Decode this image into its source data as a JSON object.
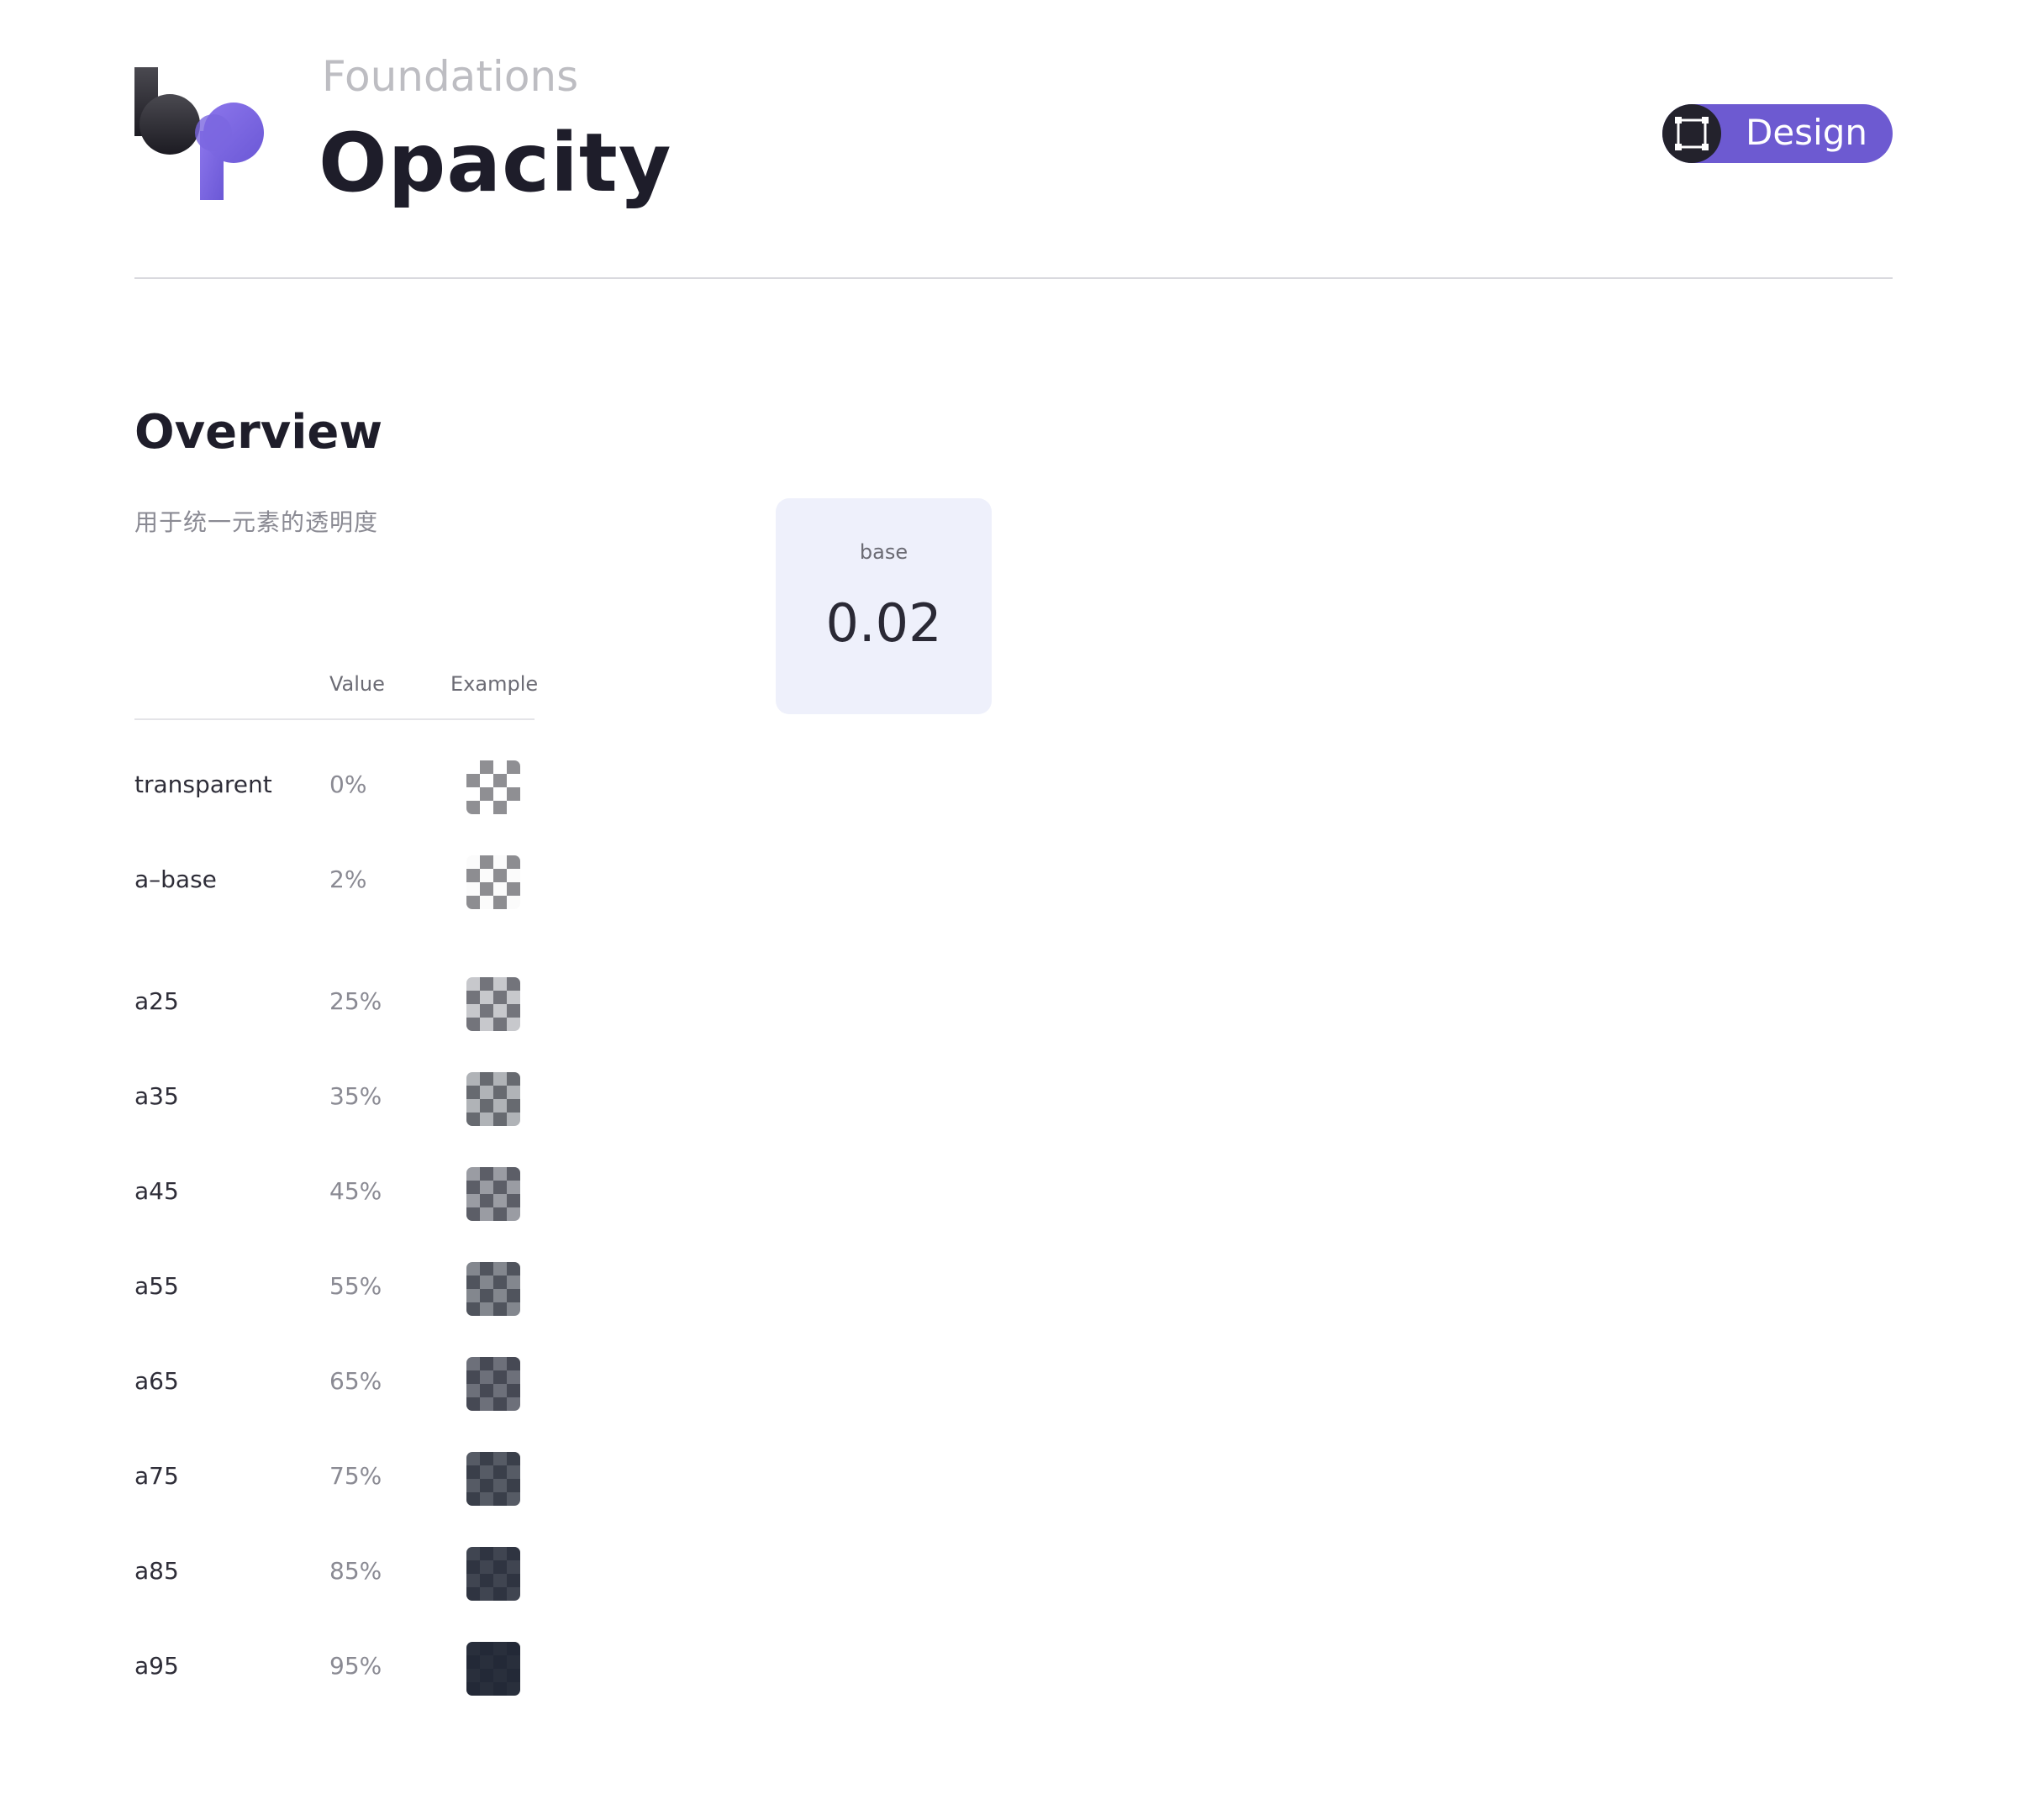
{
  "header": {
    "eyebrow": "Foundations",
    "title": "Opacity",
    "badge_label": "Design",
    "badge_icon": "frame-icon",
    "accent_color": "#6d5ad1"
  },
  "overview": {
    "title": "Overview",
    "description": "用于统一元素的透明度"
  },
  "base_card": {
    "label": "base",
    "value": "0.02"
  },
  "table": {
    "headers": {
      "name": "",
      "value": "Value",
      "example": "Example"
    },
    "overlay_color": "#1e2432",
    "rows": [
      {
        "name": "transparent",
        "value": "0%",
        "opacity": 0.0
      },
      {
        "name": "a–base",
        "value": "2%",
        "opacity": 0.02
      },
      {
        "name": "a25",
        "value": "25%",
        "opacity": 0.25
      },
      {
        "name": "a35",
        "value": "35%",
        "opacity": 0.35
      },
      {
        "name": "a45",
        "value": "45%",
        "opacity": 0.45
      },
      {
        "name": "a55",
        "value": "55%",
        "opacity": 0.55
      },
      {
        "name": "a65",
        "value": "65%",
        "opacity": 0.65
      },
      {
        "name": "a75",
        "value": "75%",
        "opacity": 0.75
      },
      {
        "name": "a85",
        "value": "85%",
        "opacity": 0.85
      },
      {
        "name": "a95",
        "value": "95%",
        "opacity": 0.95
      }
    ]
  }
}
